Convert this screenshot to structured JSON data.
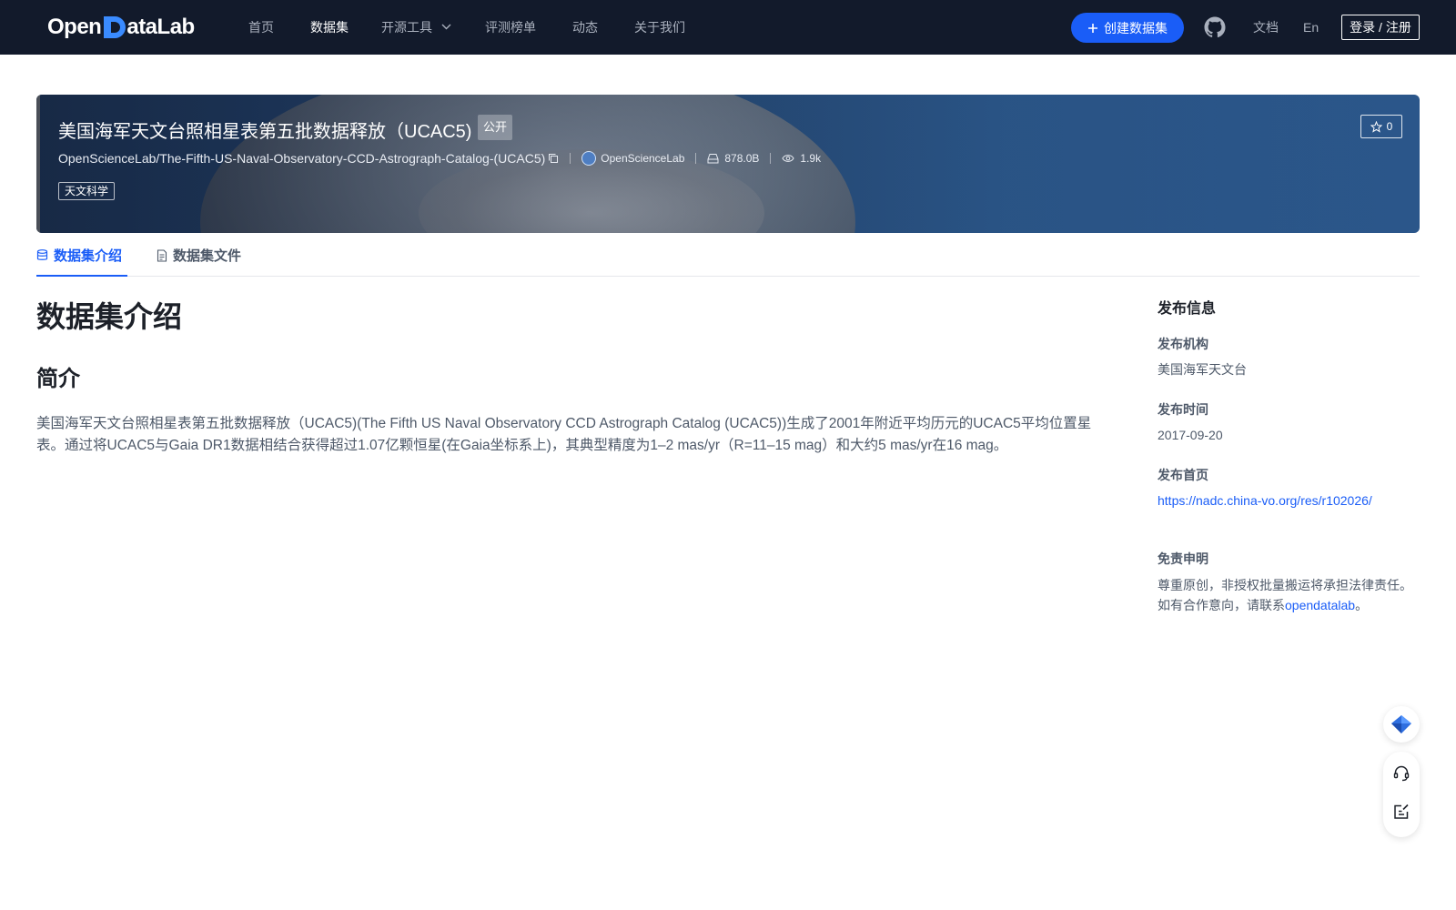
{
  "nav": {
    "logo": "OpenDataLab",
    "items": [
      {
        "label": "首页"
      },
      {
        "label": "数据集"
      },
      {
        "label": "开源工具"
      },
      {
        "label": "评测榜单"
      },
      {
        "label": "动态"
      },
      {
        "label": "关于我们"
      }
    ],
    "active_item": "数据集",
    "create_button": "创建数据集",
    "docs": "文档",
    "lang": "En",
    "login": "登录 / 注册"
  },
  "dataset": {
    "title": "美国海军天文台照相星表第五批数据释放（UCAC5)",
    "visibility": "公开",
    "repo_path": "OpenScienceLab/The-Fifth-US-Naval-Observatory-CCD-Astrograph-Catalog-(UCAC5)",
    "owner": "OpenScienceLab",
    "size": "878.0B",
    "views": "1.9k",
    "tag": "天文科学",
    "stars": "0"
  },
  "tabs": {
    "intro": "数据集介绍",
    "files": "数据集文件",
    "active": "数据集介绍"
  },
  "content": {
    "heading": "数据集介绍",
    "subheading": "简介",
    "paragraph": "美国海军天文台照相星表第五批数据释放（UCAC5)(The Fifth US Naval Observatory CCD Astrograph Catalog (UCAC5))生成了2001年附近平均历元的UCAC5平均位置星表。通过将UCAC5与Gaia DR1数据相结合获得超过1.07亿颗恒星(在Gaia坐标系上)，其典型精度为1–2 mas/yr（R=11–15 mag）和大约5 mas/yr在16 mag。"
  },
  "sidebar": {
    "title": "发布信息",
    "org_label": "发布机构",
    "org_value": "美国海军天文台",
    "date_label": "发布时间",
    "date_value": "2017-09-20",
    "home_label": "发布首页",
    "home_value": "https://nadc.china-vo.org/res/r102026/",
    "disclaimer_label": "免责申明",
    "disclaimer_line1": "尊重原创，非授权批量搬运将承担法律责任。",
    "disclaimer_line2_prefix": "如有合作意向，请联系",
    "disclaimer_link": "opendatalab",
    "disclaimer_line2_suffix": "。"
  },
  "colors": {
    "nav_bg": "#121a2b",
    "accent": "#1a5df7",
    "text_main": "#1d2129",
    "text_secondary": "#4e5969"
  },
  "icons": [
    "chevron-down-icon",
    "plus-icon",
    "github-icon",
    "copy-icon",
    "avatar-icon",
    "storage-icon",
    "eye-icon",
    "star-icon",
    "database-icon",
    "file-icon",
    "diamond-logo-icon",
    "headset-icon",
    "feedback-edit-icon"
  ]
}
